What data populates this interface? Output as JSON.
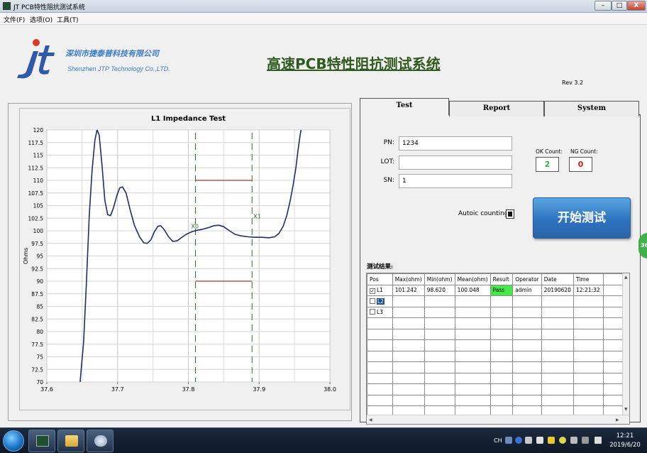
{
  "window": {
    "title": "JT PCB特性阻抗测试系统",
    "min": "–",
    "max": "□",
    "close": "X"
  },
  "menu": [
    "文件(F)",
    "选项(O)",
    "工具(T)"
  ],
  "header": {
    "logo_text": "jt",
    "company_cn": "深圳市捷泰普科技有限公司",
    "company_en": "Shenzhen JTP Technology Co.,LTD.",
    "app_title": "高速PCB特性阻抗测试系统",
    "version": "Rev 3.2"
  },
  "tabs": {
    "test": "Test",
    "report": "Report",
    "system": "System"
  },
  "form": {
    "pn_label": "PN:",
    "pn_value": "1234",
    "lot_label": "LOT:",
    "lot_value": "",
    "sn_label": "SN:",
    "sn_value": "1",
    "autoc_label": "Autoic counting?",
    "ok_label": "OK Count:",
    "ok_value": "2",
    "ng_label": "NG Count:",
    "ng_value": "0",
    "start_button": "开始测试",
    "results_label": "测试结果:"
  },
  "colors": {
    "ok": "#2fb34a",
    "ng": "#d21a1a",
    "pass": "#49e84a",
    "curve": "#1f2d6b",
    "limit": "#b03030",
    "marker": "#2f6b2f"
  },
  "results_table": {
    "columns": [
      "Pos",
      "Max(ohm)",
      "Min(ohm)",
      "Mean(ohm)",
      "Result",
      "Operator",
      "Date",
      "Time"
    ],
    "rows": [
      {
        "checked": true,
        "pos": "L1",
        "max": "101.242",
        "min": "98.620",
        "mean": "100.048",
        "result": "Pass",
        "operator": "admin",
        "date": "20190620",
        "time": "12:21:32"
      },
      {
        "checked": false,
        "pos": "L2",
        "max": "",
        "min": "",
        "mean": "",
        "result": "",
        "operator": "",
        "date": "",
        "time": ""
      },
      {
        "checked": false,
        "pos": "L3",
        "max": "",
        "min": "",
        "mean": "",
        "result": "",
        "operator": "",
        "date": "",
        "time": ""
      }
    ]
  },
  "side_badge": "36",
  "taskbar": {
    "tray_lang": "CH",
    "time": "12:21",
    "date": "2019/6/20"
  },
  "chart_data": {
    "type": "line",
    "title": "L1  Impedance Test",
    "xlabel": "",
    "ylabel": "Ohms",
    "xlim": [
      37.6,
      38.0
    ],
    "ylim": [
      70,
      120
    ],
    "x_ticks": [
      "37.6",
      "37.7",
      "37.8",
      "37.9",
      "38.0"
    ],
    "y_ticks": [
      "120",
      "117.5",
      "115",
      "112.5",
      "110",
      "107.5",
      "105",
      "102.5",
      "100",
      "97.5",
      "95",
      "92.5",
      "90",
      "87.5",
      "85",
      "82.5",
      "80",
      "77.5",
      "75",
      "72.5",
      "70"
    ],
    "grid": true,
    "markers": [
      {
        "label": "X0",
        "x": 37.81
      },
      {
        "label": "X1",
        "x": 37.89
      }
    ],
    "limits": {
      "upper": 110,
      "lower": 90,
      "x_from": 37.81,
      "x_to": 37.89
    },
    "series": [
      {
        "values": [
          [
            37.647,
            70
          ],
          [
            37.652,
            78
          ],
          [
            37.656,
            90
          ],
          [
            37.66,
            103
          ],
          [
            37.664,
            112
          ],
          [
            37.668,
            118
          ],
          [
            37.671,
            120
          ],
          [
            37.674,
            119
          ],
          [
            37.678,
            113
          ],
          [
            37.682,
            106
          ],
          [
            37.686,
            103.2
          ],
          [
            37.69,
            103
          ],
          [
            37.694,
            104.5
          ],
          [
            37.699,
            107
          ],
          [
            37.703,
            108.5
          ],
          [
            37.707,
            108.7
          ],
          [
            37.712,
            107.5
          ],
          [
            37.718,
            104
          ],
          [
            37.724,
            101
          ],
          [
            37.731,
            98.8
          ],
          [
            37.737,
            97.6
          ],
          [
            37.742,
            97.5
          ],
          [
            37.747,
            98.2
          ],
          [
            37.752,
            99.8
          ],
          [
            37.757,
            100.9
          ],
          [
            37.761,
            101
          ],
          [
            37.766,
            100.2
          ],
          [
            37.772,
            98.8
          ],
          [
            37.778,
            97.9
          ],
          [
            37.784,
            98
          ],
          [
            37.79,
            98.6
          ],
          [
            37.797,
            99.3
          ],
          [
            37.805,
            99.8
          ],
          [
            37.812,
            100.1
          ],
          [
            37.82,
            100.3
          ],
          [
            37.828,
            100.6
          ],
          [
            37.836,
            101
          ],
          [
            37.843,
            101.1
          ],
          [
            37.85,
            100.8
          ],
          [
            37.858,
            100
          ],
          [
            37.866,
            99.3
          ],
          [
            37.874,
            99
          ],
          [
            37.884,
            98.8
          ],
          [
            37.894,
            98.7
          ],
          [
            37.904,
            98.7
          ],
          [
            37.914,
            98.6
          ],
          [
            37.922,
            98.8
          ],
          [
            37.928,
            99.5
          ],
          [
            37.934,
            100.9
          ],
          [
            37.939,
            103
          ],
          [
            37.944,
            106
          ],
          [
            37.948,
            109
          ],
          [
            37.952,
            112.5
          ],
          [
            37.955,
            116
          ],
          [
            37.958,
            119
          ],
          [
            37.96,
            120.5
          ]
        ]
      }
    ]
  }
}
